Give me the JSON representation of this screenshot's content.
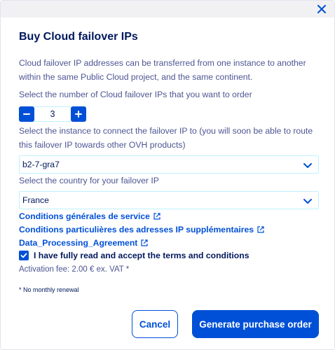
{
  "modal": {
    "title": "Buy Cloud failover IPs",
    "description": "Cloud failover IP addresses can be transferred from one instance to another within the same Public Cloud project, and the same continent."
  },
  "quantity": {
    "label": "Select the number of Cloud failover IPs that you want to order",
    "value": "3",
    "decrement": "−",
    "increment": "+"
  },
  "instance": {
    "label": "Select the instance to connect the failover IP to (you will soon be able to route this failover IP towards other OVH products)",
    "selected": "b2-7-gra7"
  },
  "country": {
    "label": "Select the country for your failover IP",
    "selected": "France"
  },
  "links": [
    {
      "label": "Conditions générales de service"
    },
    {
      "label": "Conditions particulières des adresses IP supplémentaires"
    },
    {
      "label": "Data_Processing_Agreement"
    }
  ],
  "terms": {
    "label": "I have fully read and accept the terms and conditions",
    "checked": true
  },
  "fee": "Activation fee: 2.00 € ex. VAT *",
  "note": "* No monthly renewal",
  "buttons": {
    "cancel": "Cancel",
    "submit": "Generate purchase order"
  },
  "colors": {
    "primary": "#0050d7",
    "title": "#00185e",
    "text": "#4d5592",
    "input_border": "#bef1ff"
  },
  "icons": {
    "close": "close-icon",
    "chevron": "chevron-down-icon",
    "external": "external-link-icon",
    "check": "check-icon"
  }
}
